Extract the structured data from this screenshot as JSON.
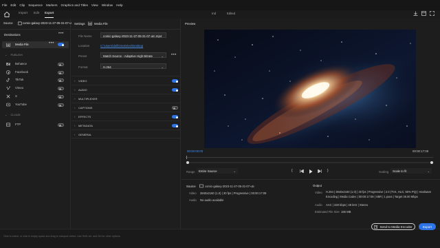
{
  "menu": [
    "File",
    "Edit",
    "Clip",
    "Sequence",
    "Markers",
    "Graphics and Titles",
    "View",
    "Window",
    "Help"
  ],
  "tabs": [
    "Import",
    "Edit",
    "Export"
  ],
  "header": {
    "sub_left": "Ind",
    "sub_right": "Edited"
  },
  "source": {
    "label": "Source",
    "file": "comic-galaxy-2023-11-27-05-31-07-utc"
  },
  "destinations": {
    "title": "Destinations",
    "media_file": "Media File",
    "publish_label": "PUBLISH",
    "publish": [
      "Behance",
      "Facebook",
      "TikTok",
      "Vimeo",
      "X",
      "YouTube"
    ],
    "cloud_label": "CLOUD",
    "cloud": [
      "FTP"
    ]
  },
  "settings": {
    "title": "Settings",
    "target": "Media File",
    "file_name_label": "File Name",
    "file_name": "comic-galaxy-2023-11-27-05-31-07-utc.mp4",
    "location_label": "Location",
    "location": "C:\\Users\\dell\\OneDrive\\Desktop",
    "preset_label": "Preset",
    "preset": "Match Source - Adaptive High Bitrate",
    "format_label": "Format",
    "format": "H.264",
    "sections": [
      {
        "label": "VIDEO",
        "toggle": "on"
      },
      {
        "label": "AUDIO",
        "toggle": "on"
      },
      {
        "label": "MULTIPLEXER",
        "toggle": "none"
      },
      {
        "label": "CAPTIONS",
        "toggle": "off"
      },
      {
        "label": "EFFECTS",
        "toggle": "on"
      },
      {
        "label": "METADATA",
        "toggle": "on"
      },
      {
        "label": "GENERAL",
        "toggle": "none"
      }
    ]
  },
  "preview": {
    "title": "Preview",
    "timecode_start": "00:00:00:00",
    "timecode_end": "00:00:17:09",
    "range_label": "Range",
    "range_value": "Entire Source",
    "scaling_label": "Scaling",
    "scaling_value": "Scale to fit"
  },
  "source_info": {
    "title": "Source",
    "file": "comic-galaxy-2023-11-27-05-31-07-utc",
    "video_label": "Video",
    "video_value": "3840x2160 (1.0)  |  30 fps  |  Progressive  |  00:00:17:09",
    "audio_label": "Audio",
    "audio_value": "No audio available"
  },
  "output_info": {
    "title": "Output",
    "video_label": "Video",
    "video_value": "H.264  |  3840x2160 (1.0)  |  30 fps  |  Progressive  |  2.0 (TV4, HLG, 50% PQ)  |  Hardware Encoding  |  Media Codec  |  00:00:17:09  |  VBR  |  1 pass  |  Target 36.00 Mbps",
    "audio_label": "Audio",
    "audio_value": "AAC  |  320 kbps  |  48 kHz  |  Stereo",
    "size_label": "Estimated File Size",
    "size_value": "165 MB"
  },
  "footer": {
    "status": "Click to select, or click in empty space and drag to marquee select. Use Shift, Alt, and Ctrl for other options.",
    "send_button": "Send to Media Encoder",
    "export_button": "Export"
  },
  "colors": {
    "accent": "#2e74e6",
    "link": "#4a8fe8"
  }
}
